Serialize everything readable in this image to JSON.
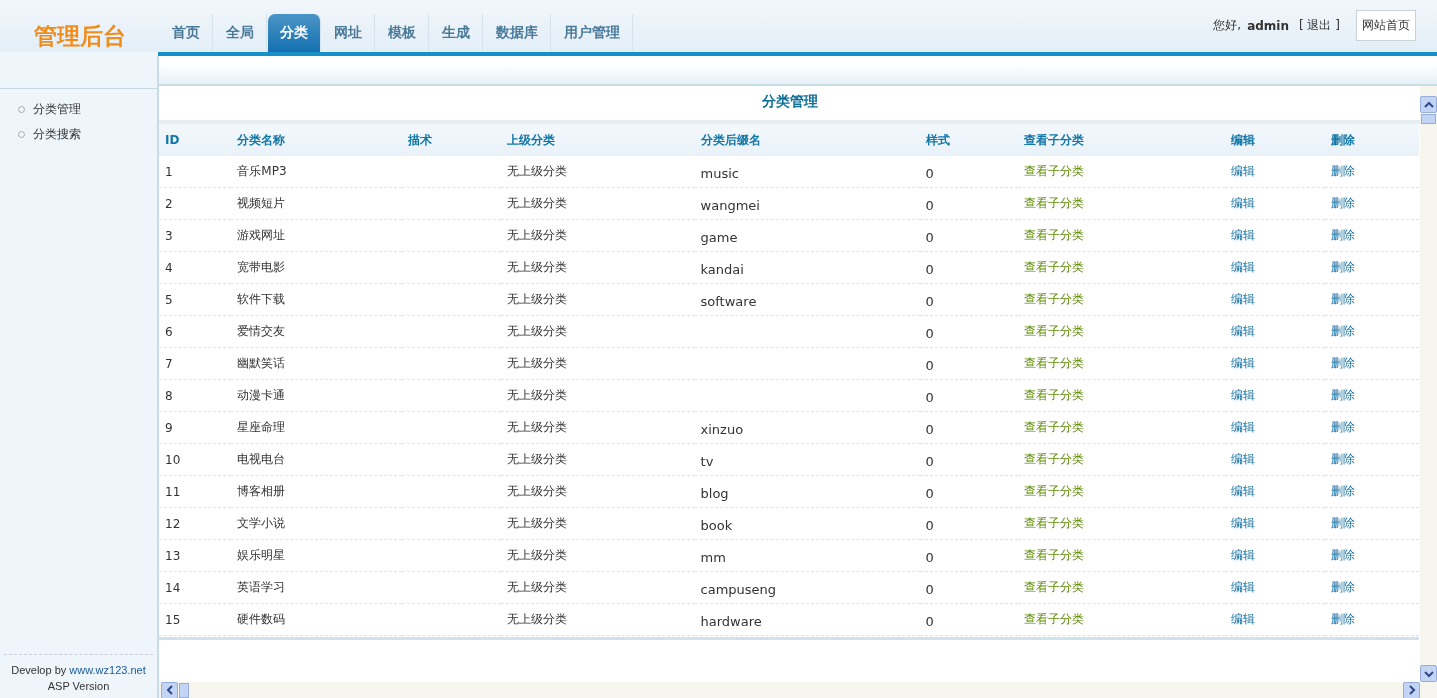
{
  "logo": "管理后台",
  "tabs": [
    {
      "label": "首页",
      "selected": false
    },
    {
      "label": "全局",
      "selected": false
    },
    {
      "label": "分类",
      "selected": true
    },
    {
      "label": "网址",
      "selected": false
    },
    {
      "label": "模板",
      "selected": false
    },
    {
      "label": "生成",
      "selected": false
    },
    {
      "label": "数据库",
      "selected": false
    },
    {
      "label": "用户管理",
      "selected": false
    }
  ],
  "user": {
    "greeting": "您好,",
    "name": "admin",
    "logout": "[ 退出 ]",
    "home_button": "网站首页"
  },
  "sidebar": {
    "items": [
      "分类管理",
      "分类搜索"
    ],
    "footer_prefix": "Develop by",
    "footer_link": "www.wz123.net",
    "footer_version": "ASP Version"
  },
  "panel_title": "分类管理",
  "table": {
    "columns": [
      "ID",
      "分类名称",
      "描术",
      "上级分类",
      "分类后缀名",
      "样式",
      "查看子分类",
      "编辑",
      "删除"
    ],
    "rows": [
      {
        "id": "1",
        "name": "音乐MP3",
        "parent": "无上级分类",
        "suffix": "music",
        "style": "0",
        "view": "查看子分类",
        "edit": "编辑",
        "delete": "删除"
      },
      {
        "id": "2",
        "name": "视频短片",
        "parent": "无上级分类",
        "suffix": "wangmei",
        "style": "0",
        "view": "查看子分类",
        "edit": "编辑",
        "delete": "删除"
      },
      {
        "id": "3",
        "name": "游戏网址",
        "parent": "无上级分类",
        "suffix": "game",
        "style": "0",
        "view": "查看子分类",
        "edit": "编辑",
        "delete": "删除"
      },
      {
        "id": "4",
        "name": "宽带电影",
        "parent": "无上级分类",
        "suffix": "kandai",
        "style": "0",
        "view": "查看子分类",
        "edit": "编辑",
        "delete": "删除"
      },
      {
        "id": "5",
        "name": "软件下载",
        "parent": "无上级分类",
        "suffix": "software",
        "style": "0",
        "view": "查看子分类",
        "edit": "编辑",
        "delete": "删除"
      },
      {
        "id": "6",
        "name": "爱情交友",
        "parent": "无上级分类",
        "style": "0",
        "view": "查看子分类",
        "edit": "编辑",
        "delete": "删除"
      },
      {
        "id": "7",
        "name": "幽默笑话",
        "parent": "无上级分类",
        "style": "0",
        "view": "查看子分类",
        "edit": "编辑",
        "delete": "删除"
      },
      {
        "id": "8",
        "name": "动漫卡通",
        "parent": "无上级分类",
        "style": "0",
        "view": "查看子分类",
        "edit": "编辑",
        "delete": "删除"
      },
      {
        "id": "9",
        "name": "星座命理",
        "parent": "无上级分类",
        "suffix": "xinzuo",
        "style": "0",
        "view": "查看子分类",
        "edit": "编辑",
        "delete": "删除"
      },
      {
        "id": "10",
        "name": "电视电台",
        "parent": "无上级分类",
        "suffix": "tv",
        "style": "0",
        "view": "查看子分类",
        "edit": "编辑",
        "delete": "删除"
      },
      {
        "id": "11",
        "name": "博客相册",
        "parent": "无上级分类",
        "suffix": "blog",
        "style": "0",
        "view": "查看子分类",
        "edit": "编辑",
        "delete": "删除"
      },
      {
        "id": "12",
        "name": "文学小说",
        "parent": "无上级分类",
        "suffix": "book",
        "style": "0",
        "view": "查看子分类",
        "edit": "编辑",
        "delete": "删除"
      },
      {
        "id": "13",
        "name": "娱乐明星",
        "parent": "无上级分类",
        "suffix": "mm",
        "style": "0",
        "view": "查看子分类",
        "edit": "编辑",
        "delete": "删除"
      },
      {
        "id": "14",
        "name": "英语学习",
        "parent": "无上级分类",
        "suffix": "campuseng",
        "style": "0",
        "view": "查看子分类",
        "edit": "编辑",
        "delete": "删除"
      },
      {
        "id": "15",
        "name": "硬件数码",
        "parent": "无上级分类",
        "suffix": "hardware",
        "style": "0",
        "view": "查看子分类",
        "edit": "编辑",
        "delete": "删除"
      }
    ]
  }
}
